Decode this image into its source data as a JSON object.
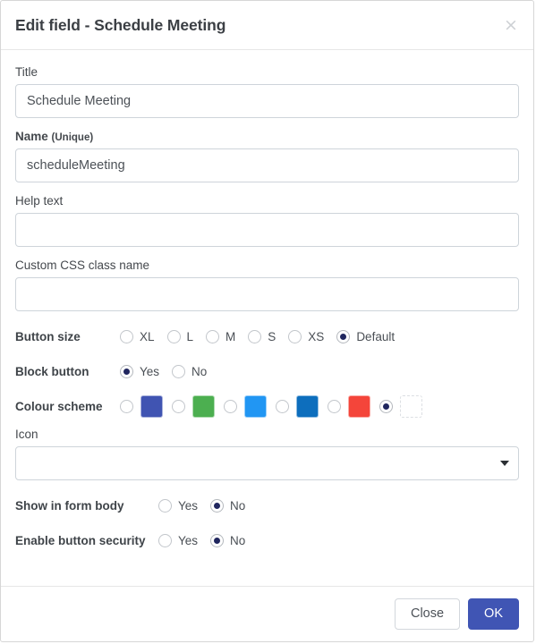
{
  "dialog": {
    "title": "Edit field - Schedule Meeting",
    "close_icon": "close-icon",
    "close_glyph": "×"
  },
  "fields": {
    "title": {
      "label": "Title",
      "value": "Schedule Meeting",
      "placeholder": ""
    },
    "name": {
      "label": "Name",
      "label_sub": "(Unique)",
      "value": "scheduleMeeting",
      "placeholder": ""
    },
    "help_text": {
      "label": "Help text",
      "value": "",
      "placeholder": ""
    },
    "custom_css": {
      "label": "Custom CSS class name",
      "value": "",
      "placeholder": ""
    },
    "icon": {
      "label": "Icon",
      "value": "",
      "placeholder": "",
      "arrow_icon": "chevron-down-icon"
    }
  },
  "button_size": {
    "label": "Button size",
    "options": [
      {
        "label": "XL",
        "selected": false
      },
      {
        "label": "L",
        "selected": false
      },
      {
        "label": "M",
        "selected": false
      },
      {
        "label": "S",
        "selected": false
      },
      {
        "label": "XS",
        "selected": false
      },
      {
        "label": "Default",
        "selected": true
      }
    ]
  },
  "block_button": {
    "label": "Block button",
    "options": [
      {
        "label": "Yes",
        "selected": true
      },
      {
        "label": "No",
        "selected": false
      }
    ]
  },
  "colour_scheme": {
    "label": "Colour scheme",
    "options": [
      {
        "name": "indigo",
        "color": "#4054b2",
        "selected": false
      },
      {
        "name": "green",
        "color": "#4caf50",
        "selected": false
      },
      {
        "name": "light-blue",
        "color": "#2196f3",
        "selected": false
      },
      {
        "name": "blue",
        "color": "#0d6ebd",
        "selected": false
      },
      {
        "name": "red",
        "color": "#f4453a",
        "selected": false
      },
      {
        "name": "none",
        "color": "#ffffff",
        "selected": true
      }
    ]
  },
  "show_in_form_body": {
    "label": "Show in form body",
    "options": [
      {
        "label": "Yes",
        "selected": false
      },
      {
        "label": "No",
        "selected": true
      }
    ]
  },
  "enable_button_security": {
    "label": "Enable button security",
    "options": [
      {
        "label": "Yes",
        "selected": false
      },
      {
        "label": "No",
        "selected": true
      }
    ]
  },
  "footer": {
    "close_label": "Close",
    "ok_label": "OK",
    "ok_color": "#4055b4"
  }
}
